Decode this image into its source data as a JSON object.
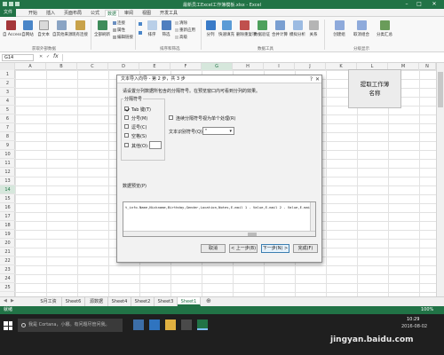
{
  "window": {
    "title": "最新员工Excel工作簿模板.xlsx - Excel"
  },
  "tabs": [
    "开始",
    "插入",
    "页面布局",
    "公式",
    "数据",
    "审阅",
    "视图",
    "开发工具"
  ],
  "file_tab": "文件",
  "active_tab": "数据",
  "ribbon": {
    "get_external": {
      "access": "自 Access",
      "web": "自网站",
      "text": "自文本",
      "other": "自其他来源",
      "existing": "现有连接",
      "group_label": "获取外部数据"
    },
    "connections": {
      "refresh": "全部刷新",
      "conn": "连接",
      "props": "属性",
      "edit_links": "编辑链接"
    },
    "sort_filter": {
      "sort": "排序",
      "filter": "筛选",
      "clear": "清除",
      "reapply": "重新应用",
      "advanced": "高级",
      "group_label": "排序和筛选"
    },
    "tools": {
      "split": "分列",
      "flash": "快速填充",
      "dedupe": "删除重复项",
      "validate": "数据验证",
      "consolidate": "合并计算",
      "whatif": "模拟分析",
      "relationships": "关系",
      "group_label": "数据工具"
    },
    "outline": {
      "group": "创建组",
      "ungroup": "取消组合",
      "subtotal": "分类汇总",
      "group_label": "分级显示"
    }
  },
  "namebox": {
    "value": "G14"
  },
  "columns": [
    "A",
    "B",
    "C",
    "D",
    "E",
    "F",
    "G",
    "H",
    "I",
    "J",
    "K",
    "L",
    "M",
    "N"
  ],
  "rows": [
    "1",
    "2",
    "3",
    "4",
    "5",
    "6",
    "7",
    "8",
    "9",
    "10",
    "11",
    "12",
    "13",
    "14",
    "15",
    "16",
    "17",
    "18",
    "19",
    "20",
    "21",
    "22",
    "23",
    "24",
    "25"
  ],
  "macro_button": {
    "label": "提取工作薄\n名称"
  },
  "dialog": {
    "title": "文本导入向导 - 第 2 步，共 3 步",
    "close": "?",
    "instruction": "请设置分列数据所包含的分隔符号。在预览窗口内可看到分列的效果。",
    "delimiters_label": "分隔符号",
    "delimiters": [
      {
        "label": "Tab 键(T)",
        "checked": true
      },
      {
        "label": "分号(M)",
        "checked": false
      },
      {
        "label": "逗号(C)",
        "checked": false
      },
      {
        "label": "空格(S)",
        "checked": false
      },
      {
        "label": "其他(O):",
        "checked": false
      }
    ],
    "consecutive": {
      "label": "连续分隔符号视为单个处理(R)",
      "checked": false
    },
    "qualifier": {
      "label": "文本识别符号(Q):",
      "value": "\""
    },
    "preview_label": "数据预览(P)",
    "preview_text": "t_info.Name,Nickname,Birthday,Gender,Location,Notes,E-mail 1 - Value,E-mail 2 - Value,E-mail",
    "buttons": {
      "cancel": "取消",
      "back": "< 上一步(B)",
      "next": "下一步(N) >",
      "finish": "完成(F)"
    }
  },
  "sheets": [
    {
      "label": "S月工资",
      "active": false
    },
    {
      "label": "Sheet6",
      "active": false
    },
    {
      "label": "源数据",
      "active": false
    },
    {
      "label": "Sheet4",
      "active": false
    },
    {
      "label": "Sheet2",
      "active": false
    },
    {
      "label": "Sheet3",
      "active": false
    },
    {
      "label": "Sheet1",
      "active": true
    }
  ],
  "status": {
    "ready": "就绪",
    "zoom": "100%"
  },
  "taskbar": {
    "search": "我是 Cortana，小娜。有问题尽管问我。",
    "time": "10:29",
    "date": "2016-08-02",
    "watermark": "jingyan.baidu.com"
  },
  "colors": {
    "excel_green": "#217346"
  }
}
